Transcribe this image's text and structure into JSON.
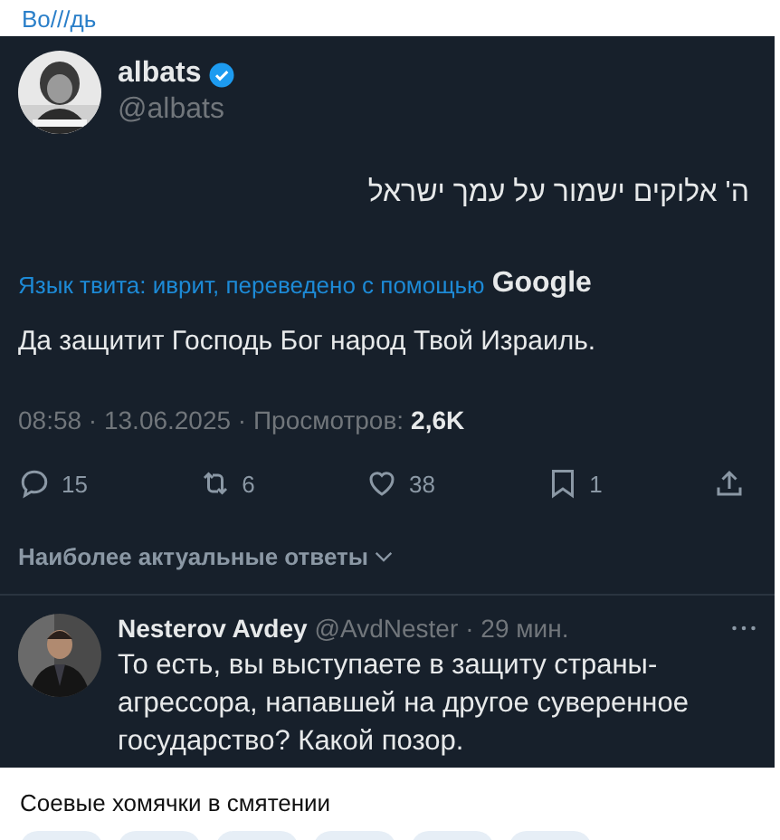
{
  "channel_title": "Во///дь",
  "tweet": {
    "author": {
      "name": "albats",
      "handle": "@albats",
      "verified": true
    },
    "text": "ה' אלוקים ישמור על עמך ישראל",
    "translation_note": "Язык твита: иврит, переведено с помощью",
    "translator": "Google",
    "translation": "Да защитит Господь Бог народ Твой Израиль.",
    "meta": "08:58 · 13.06.2025 · Просмотров:",
    "views": "2,6K",
    "actions": [
      {
        "kind": "reply",
        "count": "15"
      },
      {
        "kind": "repost",
        "count": "6"
      },
      {
        "kind": "like",
        "count": "38"
      },
      {
        "kind": "bookmark",
        "count": "1"
      },
      {
        "kind": "share"
      }
    ]
  },
  "replies_sort": "Наиболее актуальные ответы",
  "reply": {
    "name": "Nesterov Avdey",
    "handle": "@AvdNester",
    "time": "· 29 мин.",
    "text": "То есть, вы выступаете в защиту страны-агрессора, напавшей на другое суверенное государство? Какой позор."
  },
  "caption": "Соевые хомячки в смятении"
}
